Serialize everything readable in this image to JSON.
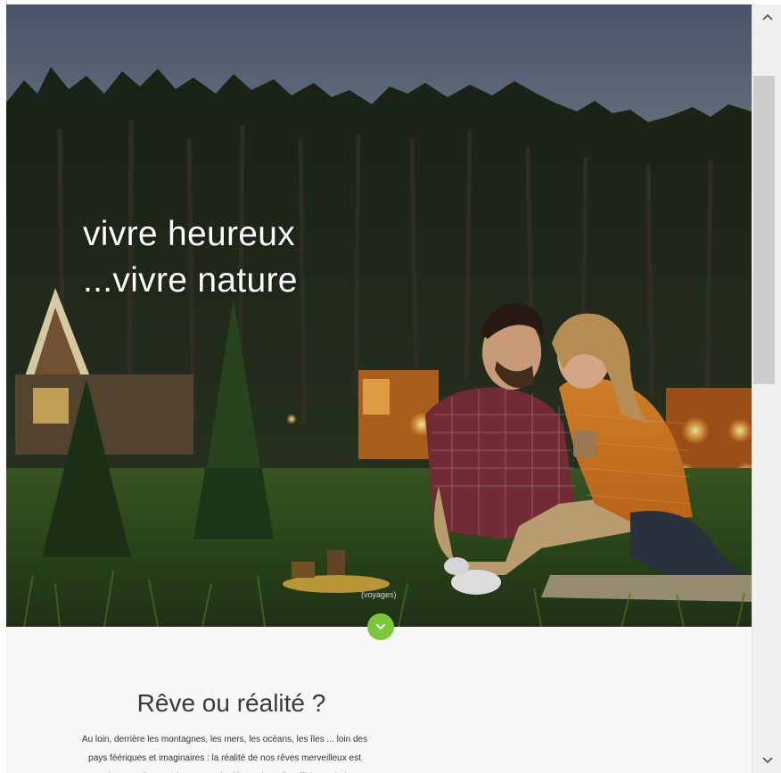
{
  "hero": {
    "title_line1": "vivre heureux",
    "title_line2": "...vivre nature",
    "caption": "(voyages)",
    "scroll_down_icon": "chevron-down-icon"
  },
  "intro": {
    "title": "Rêve ou réalité ?",
    "text": "Au loin, derrière les montagnes, les mers, les océans, les îles ... loin des pays féériques et imaginaires : la réalité de nos rêves merveilleux est présente, elle attend que nous la découvrions, il suffit juste de la"
  },
  "scrollbar": {
    "up_icon": "caret-up-icon",
    "down_icon": "caret-down-icon"
  },
  "colors": {
    "accent_green": "#7cc63a",
    "sky": "#5f6c80",
    "forest": "#1d2718"
  }
}
